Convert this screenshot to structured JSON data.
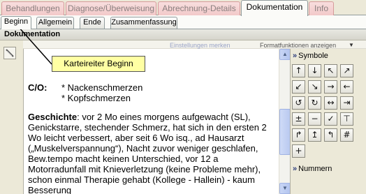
{
  "top_tabs": [
    {
      "label": "Behandlungen",
      "active": false
    },
    {
      "label": "Diagnose/Überweisung",
      "active": false
    },
    {
      "label": "Abrechnung-Details",
      "active": false
    },
    {
      "label": "Dokumentation",
      "active": true
    },
    {
      "label": "Info",
      "active": false
    }
  ],
  "sub_tabs": [
    {
      "label": "Beginn",
      "active": true
    },
    {
      "label": "Allgemein",
      "active": false
    },
    {
      "label": "Ende",
      "active": false
    },
    {
      "label": "Zusammenfassung",
      "active": false
    }
  ],
  "section_title": "Dokumentation",
  "toolbar": {
    "settings_label": "Einstellungen merken",
    "formats_label": "Formatfunktionen anzeigen"
  },
  "callout_text": "Karteireiter Beginn",
  "document": {
    "co_label": "C/O:",
    "co_lines": [
      "* Nackenschmerzen",
      "* Kopfschmerzen"
    ],
    "history_label": "Geschichte",
    "history_text": ": vor 2 Mo eines morgens aufgewacht (SL), Genickstarre, stechender Schmerz, hat sich in den ersten 2 Wo leicht verbessert, aber seit 6 Wo isq., ad Hausarzt („Muskelverspannung“), Nacht zuvor weniger geschlafen, Bew.tempo macht keinen Unterschied, vor 12 a Motorradunfall mit Knieverletzung (keine Probleme mehr), schon einmal Therapie gehabt (Kollege - Hallein) - kaum Besserung"
  },
  "symbols_panel": {
    "title": "Symbole",
    "icons": [
      "arrow-up",
      "arrow-down",
      "arrow-up-left",
      "arrow-up-right",
      "arrow-down-left",
      "arrow-down-right",
      "arrow-right",
      "arrow-left",
      "rotate-left",
      "rotate-right",
      "arrows-horizontal",
      "arrows-inward",
      "plus-minus",
      "minus",
      "check",
      "arrow-up-bar",
      "corner-left",
      "corner-up",
      "corner-right",
      "hash",
      "plus"
    ],
    "glyphs": [
      "↑",
      "↓",
      "↖",
      "↗",
      "↙",
      "↘",
      "→",
      "←",
      "↺",
      "↻",
      "↔",
      "⇥",
      "±",
      "−",
      "✓",
      "⊤",
      "↱",
      "↥",
      "↰",
      "#",
      "+"
    ],
    "numbers_label": "Nummern"
  }
}
